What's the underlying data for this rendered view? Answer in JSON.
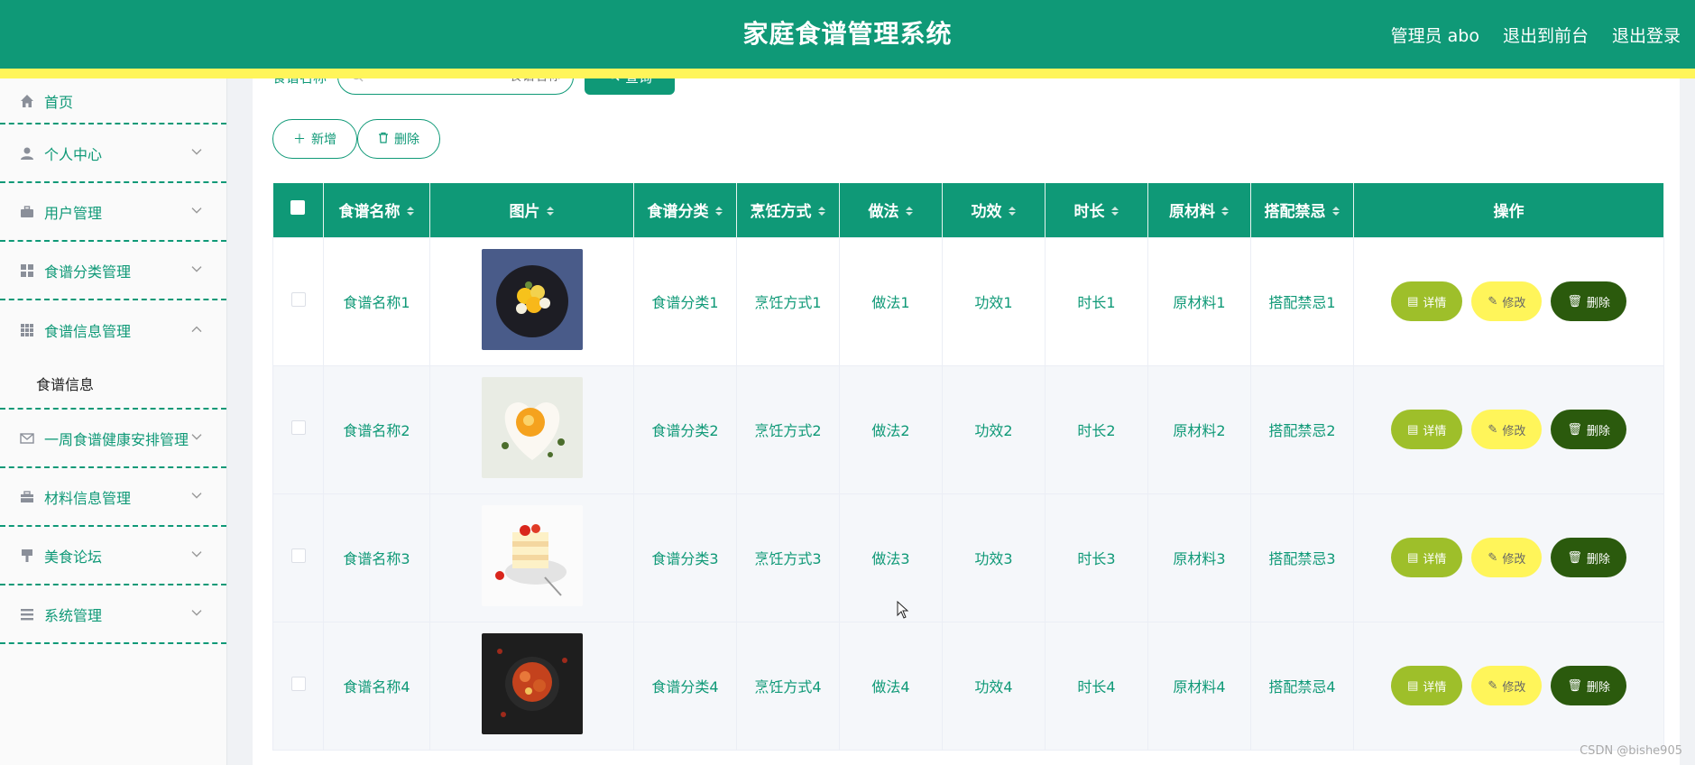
{
  "header": {
    "title": "家庭食谱管理系统",
    "admin": "管理员 abo",
    "to_front": "退出到前台",
    "logout": "退出登录"
  },
  "sidebar": {
    "items": [
      {
        "label": "首页",
        "icon": "home-icon"
      },
      {
        "label": "个人中心",
        "icon": "user-icon"
      },
      {
        "label": "用户管理",
        "icon": "briefcase-icon"
      },
      {
        "label": "食谱分类管理",
        "icon": "grid-icon"
      },
      {
        "label": "食谱信息管理",
        "icon": "apps-icon",
        "expanded": true,
        "children": [
          "食谱信息"
        ]
      },
      {
        "label": "一周食谱健康安排管理",
        "icon": "mail-icon"
      },
      {
        "label": "材料信息管理",
        "icon": "toolbox-icon"
      },
      {
        "label": "美食论坛",
        "icon": "brush-icon"
      },
      {
        "label": "系统管理",
        "icon": "list-icon"
      }
    ]
  },
  "search": {
    "label": "食谱名称",
    "placeholder": "食谱名称",
    "button": "查询"
  },
  "actions": {
    "add": "新增",
    "delete": "删除"
  },
  "table": {
    "columns": [
      "食谱名称",
      "图片",
      "食谱分类",
      "烹饪方式",
      "做法",
      "功效",
      "时长",
      "原材料",
      "搭配禁忌",
      "操作"
    ],
    "rows": [
      {
        "name": "食谱名称1",
        "category": "食谱分类1",
        "method": "烹饪方式1",
        "practice": "做法1",
        "effect": "功效1",
        "duration": "时长1",
        "material": "原材料1",
        "taboo": "搭配禁忌1"
      },
      {
        "name": "食谱名称2",
        "category": "食谱分类2",
        "method": "烹饪方式2",
        "practice": "做法2",
        "effect": "功效2",
        "duration": "时长2",
        "material": "原材料2",
        "taboo": "搭配禁忌2"
      },
      {
        "name": "食谱名称3",
        "category": "食谱分类3",
        "method": "烹饪方式3",
        "practice": "做法3",
        "effect": "功效3",
        "duration": "时长3",
        "material": "原材料3",
        "taboo": "搭配禁忌3"
      },
      {
        "name": "食谱名称4",
        "category": "食谱分类4",
        "method": "烹饪方式4",
        "practice": "做法4",
        "effect": "功效4",
        "duration": "时长4",
        "material": "原材料4",
        "taboo": "搭配禁忌4"
      }
    ],
    "ops": {
      "detail": "详情",
      "edit": "修改",
      "delete": "删除"
    }
  },
  "watermark": "CSDN @bishe905",
  "colors": {
    "primary": "#0f9977",
    "accent_yellow": "#fff55a",
    "detail_btn": "#9ebf2a",
    "delete_btn": "#2b5a0d"
  }
}
